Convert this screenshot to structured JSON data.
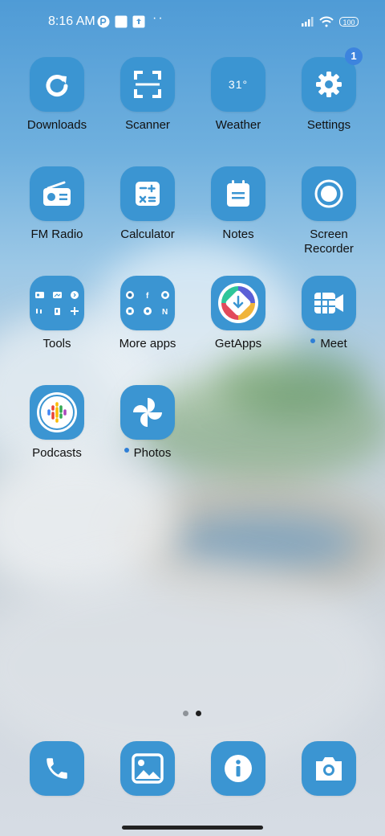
{
  "status_bar": {
    "time": "8:16 AM",
    "dots": "··",
    "battery_level": "100",
    "icons": [
      "notification-app-icon",
      "square-notification-icon",
      "upload-notification-icon",
      "signal-icon",
      "wifi-icon",
      "battery-icon"
    ]
  },
  "apps": [
    {
      "label": "Downloads",
      "icon": "downloads-icon"
    },
    {
      "label": "Scanner",
      "icon": "scanner-icon"
    },
    {
      "label": "Weather",
      "icon": "weather-icon",
      "temp": "31°"
    },
    {
      "label": "Settings",
      "icon": "gear-icon",
      "badge": "1"
    },
    {
      "label": "FM Radio",
      "icon": "radio-icon"
    },
    {
      "label": "Calculator",
      "icon": "calculator-icon"
    },
    {
      "label": "Notes",
      "icon": "notes-icon"
    },
    {
      "label": "Screen Recorder",
      "icon": "record-icon"
    },
    {
      "label": "Tools",
      "icon": "folder-icon"
    },
    {
      "label": "More apps",
      "icon": "folder-icon"
    },
    {
      "label": "GetApps",
      "icon": "getapps-icon"
    },
    {
      "label": "Meet",
      "icon": "meet-icon",
      "new_dot": true
    },
    {
      "label": "Podcasts",
      "icon": "podcasts-icon"
    },
    {
      "label": "Photos",
      "icon": "pinwheel-icon",
      "new_dot": true
    }
  ],
  "dock": [
    {
      "icon": "phone-icon"
    },
    {
      "icon": "gallery-icon"
    },
    {
      "icon": "info-icon"
    },
    {
      "icon": "camera-icon"
    }
  ],
  "page_indicator": {
    "count": 2,
    "active": 1
  },
  "colors": {
    "tile": "#3b95d2",
    "badge": "#3d84de",
    "new_dot": "#2f7fd6"
  }
}
